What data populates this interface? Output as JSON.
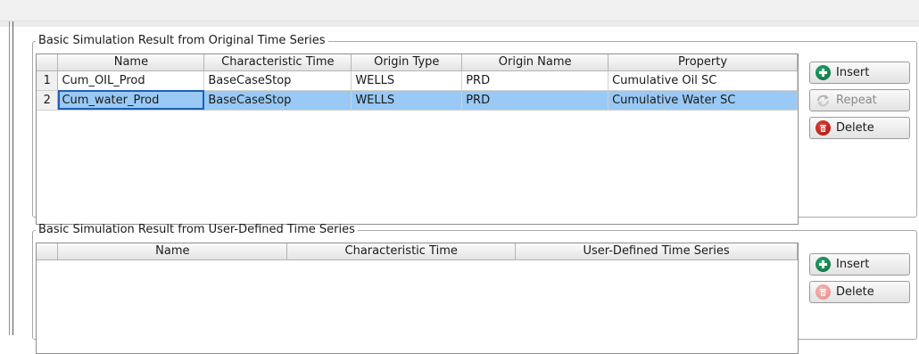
{
  "original": {
    "legend": "Basic Simulation Result from Original Time Series",
    "columns": [
      "Name",
      "Characteristic Time",
      "Origin Type",
      "Origin Name",
      "Property"
    ],
    "rows": [
      {
        "num": "1",
        "name": "Cum_OIL_Prod",
        "time": "BaseCaseStop",
        "type": "WELLS",
        "origin": "PRD",
        "property": "Cumulative Oil SC"
      },
      {
        "num": "2",
        "name": "Cum_water_Prod",
        "time": "BaseCaseStop",
        "type": "WELLS",
        "origin": "PRD",
        "property": "Cumulative Water SC"
      }
    ],
    "buttons": {
      "insert": "Insert",
      "repeat": "Repeat",
      "delete": "Delete"
    }
  },
  "user_defined": {
    "legend": "Basic Simulation Result from User-Defined Time Series",
    "columns": [
      "Name",
      "Characteristic Time",
      "User-Defined Time Series"
    ],
    "buttons": {
      "insert": "Insert",
      "delete": "Delete"
    }
  },
  "icons": {
    "insert": "plus-circle-icon",
    "repeat": "repeat-icon",
    "delete": "trash-icon"
  },
  "colors": {
    "selection": "#99c9f4",
    "insert_icon": "#0b6a3d",
    "delete_icon": "#c0201a"
  }
}
